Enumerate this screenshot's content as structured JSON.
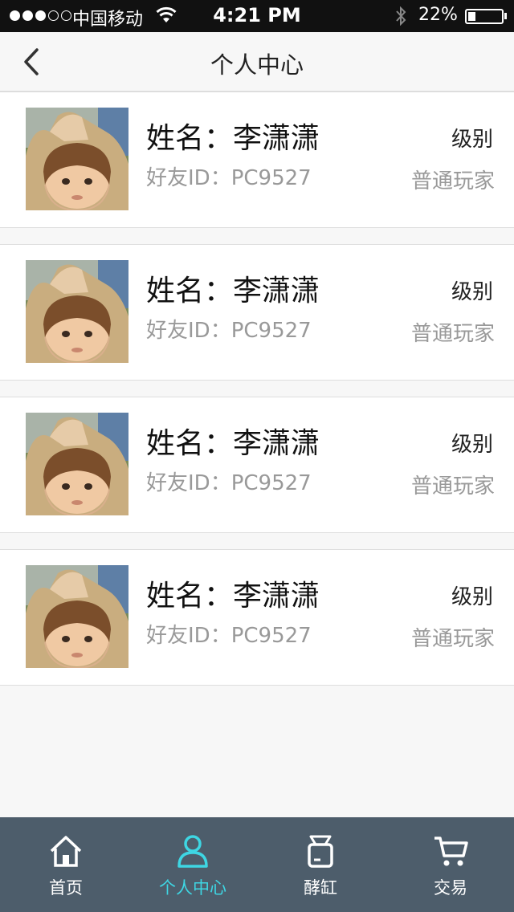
{
  "status_bar": {
    "carrier": "中国移动",
    "time": "4:21 PM",
    "battery": "22%",
    "battery_level": 0.22,
    "signal_bars_filled": 3,
    "signal_bars_total": 5
  },
  "nav": {
    "title": "个人中心",
    "back_icon": "chevron-left-icon"
  },
  "friends": [
    {
      "name": "姓名：李潇潇",
      "friend_id": "好友ID：PC9527",
      "level_label": "级别",
      "level": "普通玩家"
    },
    {
      "name": "姓名：李潇潇",
      "friend_id": "好友ID：PC9527",
      "level_label": "级别",
      "level": "普通玩家"
    },
    {
      "name": "姓名：李潇潇",
      "friend_id": "好友ID：PC9527",
      "level_label": "级别",
      "level": "普通玩家"
    },
    {
      "name": "姓名：李潇潇",
      "friend_id": "好友ID：PC9527",
      "level_label": "级别",
      "level": "普通玩家"
    }
  ],
  "tab_bar": {
    "tabs": [
      {
        "label": "首页",
        "icon": "home-icon",
        "active": false
      },
      {
        "label": "个人中心",
        "icon": "person-icon",
        "active": true
      },
      {
        "label": "酵缸",
        "icon": "jar-icon",
        "active": false
      },
      {
        "label": "交易",
        "icon": "cart-icon",
        "active": false
      }
    ]
  },
  "colors": {
    "accent": "#3ed6e3",
    "tab_bar_bg": "#4d5d6b",
    "status_bar_bg": "#111111",
    "secondary_text": "#999999"
  }
}
